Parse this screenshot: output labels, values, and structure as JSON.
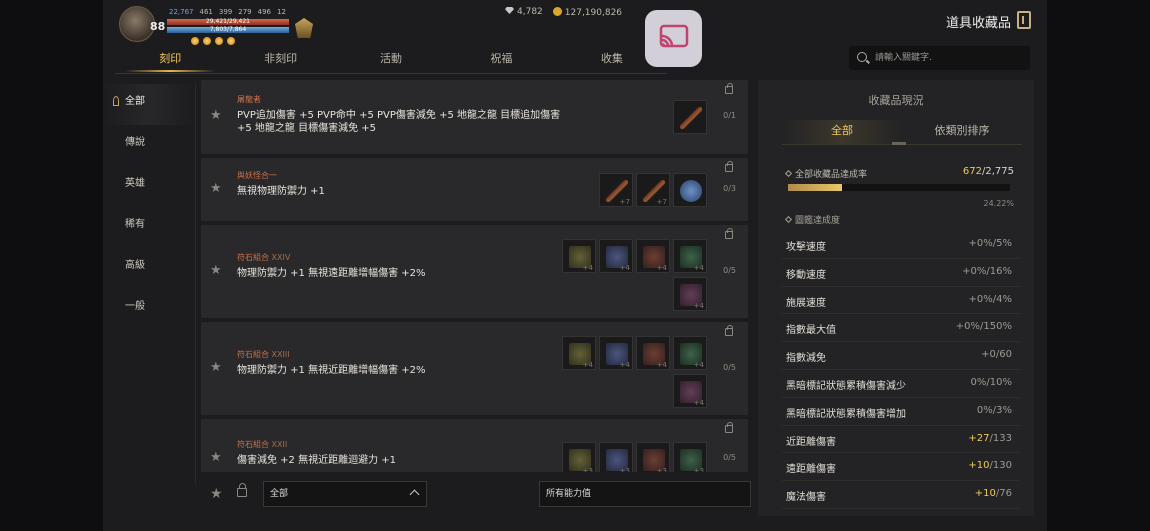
{
  "player": {
    "level": "88",
    "stats": [
      "22,767",
      "461",
      "399",
      "279",
      "496",
      "12"
    ],
    "hp": "29,421/29,421",
    "mp": "7,803/7,864"
  },
  "currency": {
    "diamonds": "4,782",
    "gold": "127,190,826"
  },
  "window_title": "道具收藏品",
  "tabs": [
    "刻印",
    "非刻印",
    "活動",
    "祝福",
    "收集"
  ],
  "search": {
    "placeholder": "請輸入關鍵字."
  },
  "categories": [
    "全部",
    "傳說",
    "英雄",
    "稀有",
    "高級",
    "一般"
  ],
  "items": [
    {
      "name": "屠龍者",
      "sub": "",
      "desc": "PVP追加傷害 +5 PVP命中 +5 PVP傷害減免 +5 地龍之龍 目標追加傷害 +5 地龍之龍 目標傷害減免 +5",
      "count": "0/1",
      "slots": [
        {
          "kind": "weapon",
          "plus": ""
        }
      ]
    },
    {
      "name": "與妖怪合一",
      "sub": "",
      "desc": "無視物理防禦力 +1",
      "count": "0/3",
      "slots": [
        {
          "kind": "weapon",
          "plus": "+7"
        },
        {
          "kind": "weapon",
          "plus": "+7"
        },
        {
          "kind": "orb",
          "plus": ""
        }
      ]
    },
    {
      "name": "符石組合",
      "sub": "XXIV",
      "desc": "物理防禦力 +1 無視遠距離增幅傷害 +2%",
      "count": "0/5",
      "slots": [
        {
          "kind": "rune-y",
          "plus": "+4"
        },
        {
          "kind": "rune-b",
          "plus": "+4"
        },
        {
          "kind": "rune-r",
          "plus": "+4"
        },
        {
          "kind": "rune-g",
          "plus": "+4"
        },
        {
          "kind": "rune-p",
          "plus": "+4"
        }
      ]
    },
    {
      "name": "符石組合",
      "sub": "XXIII",
      "desc": "物理防禦力 +1 無視近距離增幅傷害 +2%",
      "count": "0/5",
      "slots": [
        {
          "kind": "rune-y",
          "plus": "+4"
        },
        {
          "kind": "rune-b",
          "plus": "+4"
        },
        {
          "kind": "rune-r",
          "plus": "+4"
        },
        {
          "kind": "rune-g",
          "plus": "+4"
        },
        {
          "kind": "rune-p",
          "plus": "+4"
        }
      ]
    },
    {
      "name": "符石組合",
      "sub": "XXII",
      "desc": "傷害減免 +2 無視近距離迴避力 +1",
      "count": "0/5",
      "slots": [
        {
          "kind": "rune-y",
          "plus": "+3"
        },
        {
          "kind": "rune-b",
          "plus": "+3"
        },
        {
          "kind": "rune-r",
          "plus": "+3"
        },
        {
          "kind": "rune-g",
          "plus": "+3"
        }
      ]
    }
  ],
  "bottom": {
    "filter1": "全部",
    "filter2": "所有能力值"
  },
  "panel": {
    "title": "收藏品現況",
    "tabs": [
      "全部",
      "依類別排序"
    ],
    "rate_label": "全部收藏品達成率",
    "rate_current": "672",
    "rate_total": "/2,775",
    "progress": 0.2422,
    "percent": "24.22%",
    "section": "圖鑑達成度",
    "rows": [
      {
        "label": "攻擊速度",
        "cur": "+0%",
        "tot": "/5%",
        "hi": false
      },
      {
        "label": "移動速度",
        "cur": "+0%",
        "tot": "/16%",
        "hi": false
      },
      {
        "label": "施展速度",
        "cur": "+0%",
        "tot": "/4%",
        "hi": false
      },
      {
        "label": "指數最大值",
        "cur": "+0%",
        "tot": "/150%",
        "hi": false
      },
      {
        "label": "指數減免",
        "cur": "+0",
        "tot": "/60",
        "hi": false
      },
      {
        "label": "黑暗標記狀態累積傷害減少",
        "cur": "0%",
        "tot": "/10%",
        "hi": false
      },
      {
        "label": "黑暗標記狀態累積傷害增加",
        "cur": "0%",
        "tot": "/3%",
        "hi": false
      },
      {
        "label": "近距離傷害",
        "cur": "+27",
        "tot": "/133",
        "hi": true
      },
      {
        "label": "遠距離傷害",
        "cur": "+10",
        "tot": "/130",
        "hi": true
      },
      {
        "label": "魔法傷害",
        "cur": "+10",
        "tot": "/76",
        "hi": true
      }
    ]
  },
  "colors": {
    "accent": "#f0c95a",
    "item_name": "#d0704a",
    "panel_bg": "#232325"
  }
}
